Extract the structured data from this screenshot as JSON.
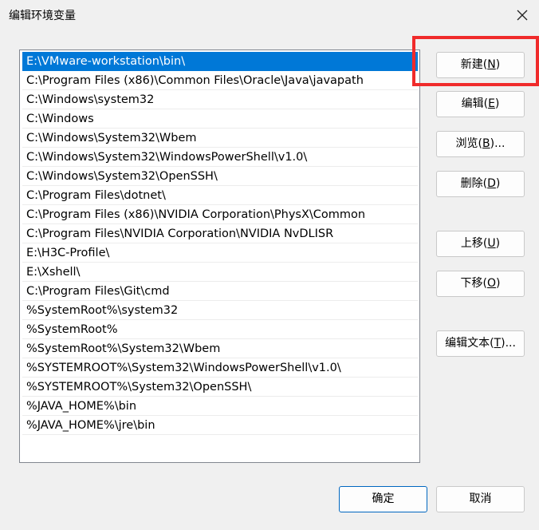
{
  "window": {
    "title": "编辑环境变量",
    "close_icon": "close-icon"
  },
  "list": {
    "items": [
      "E:\\VMware-workstation\\bin\\",
      "C:\\Program Files (x86)\\Common Files\\Oracle\\Java\\javapath",
      "C:\\Windows\\system32",
      "C:\\Windows",
      "C:\\Windows\\System32\\Wbem",
      "C:\\Windows\\System32\\WindowsPowerShell\\v1.0\\",
      "C:\\Windows\\System32\\OpenSSH\\",
      "C:\\Program Files\\dotnet\\",
      "C:\\Program Files (x86)\\NVIDIA Corporation\\PhysX\\Common",
      "C:\\Program Files\\NVIDIA Corporation\\NVIDIA NvDLISR",
      "E:\\H3C-Profile\\",
      "E:\\Xshell\\",
      "C:\\Program Files\\Git\\cmd",
      "%SystemRoot%\\system32",
      "%SystemRoot%",
      "%SystemRoot%\\System32\\Wbem",
      "%SYSTEMROOT%\\System32\\WindowsPowerShell\\v1.0\\",
      "%SYSTEMROOT%\\System32\\OpenSSH\\",
      "%JAVA_HOME%\\bin",
      "%JAVA_HOME%\\jre\\bin"
    ],
    "selected_index": 0
  },
  "buttons": {
    "new": {
      "pre": "新建(",
      "key": "N",
      "post": ")"
    },
    "edit": {
      "pre": "编辑(",
      "key": "E",
      "post": ")"
    },
    "browse": {
      "pre": "浏览(",
      "key": "B",
      "post": ")..."
    },
    "delete": {
      "pre": "删除(",
      "key": "D",
      "post": ")"
    },
    "move_up": {
      "pre": "上移(",
      "key": "U",
      "post": ")"
    },
    "move_down": {
      "pre": "下移(",
      "key": "O",
      "post": ")"
    },
    "edit_text": {
      "pre": "编辑文本(",
      "key": "T",
      "post": ")..."
    },
    "ok": "确定",
    "cancel": "取消"
  },
  "colors": {
    "selection": "#0078d7",
    "highlight_box": "#f02b2b",
    "primary_border": "#0067c0"
  }
}
